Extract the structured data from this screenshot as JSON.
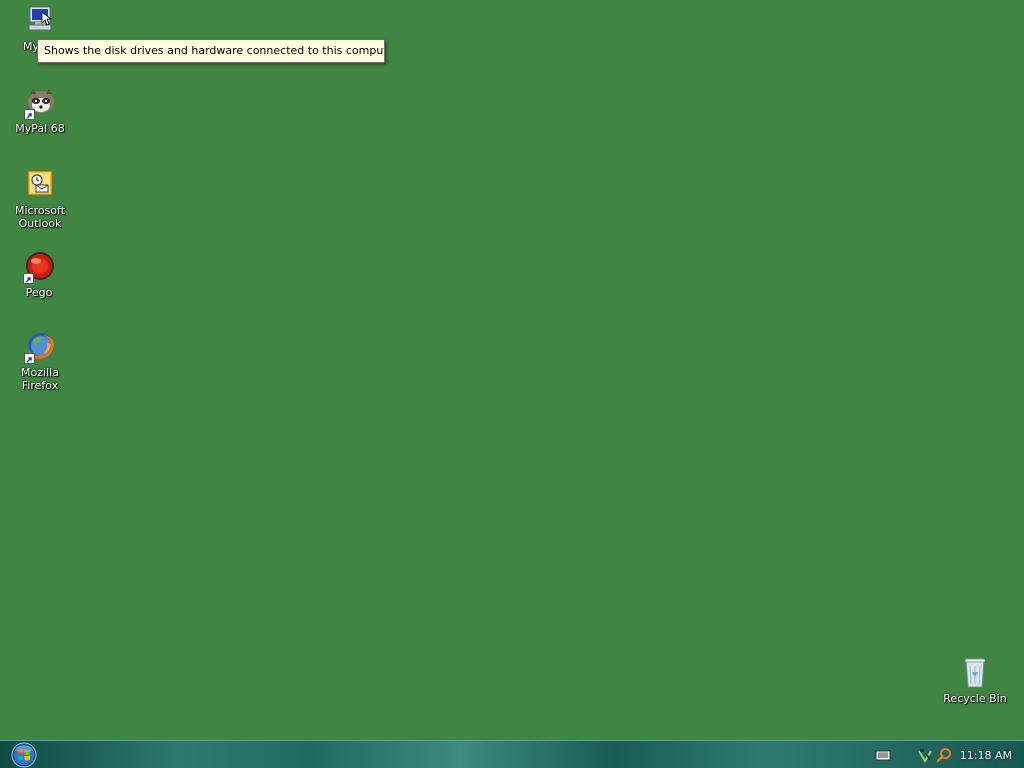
{
  "desktop": {
    "background_color": "#418543",
    "icons": [
      {
        "label": "My Co",
        "icon": "computer-icon"
      },
      {
        "label": "MyPal 68",
        "icon": "raccoon-icon"
      },
      {
        "label": "Microsoft\nOutlook",
        "icon": "outlook-icon"
      },
      {
        "label": "Pego",
        "icon": "red-ball-icon"
      },
      {
        "label": "Mozilla\nFirefox",
        "icon": "firefox-icon"
      },
      {
        "label": "Recycle Bin",
        "icon": "recycle-bin-icon"
      }
    ]
  },
  "tooltip": {
    "text": "Shows the disk drives and hardware connected to this computer."
  },
  "taskbar": {
    "start_icon": "windows-orb-icon",
    "tray": {
      "icons": [
        "keyboard-icon",
        "network-icon",
        "search-icon"
      ],
      "clock": "11:18 AM"
    }
  }
}
